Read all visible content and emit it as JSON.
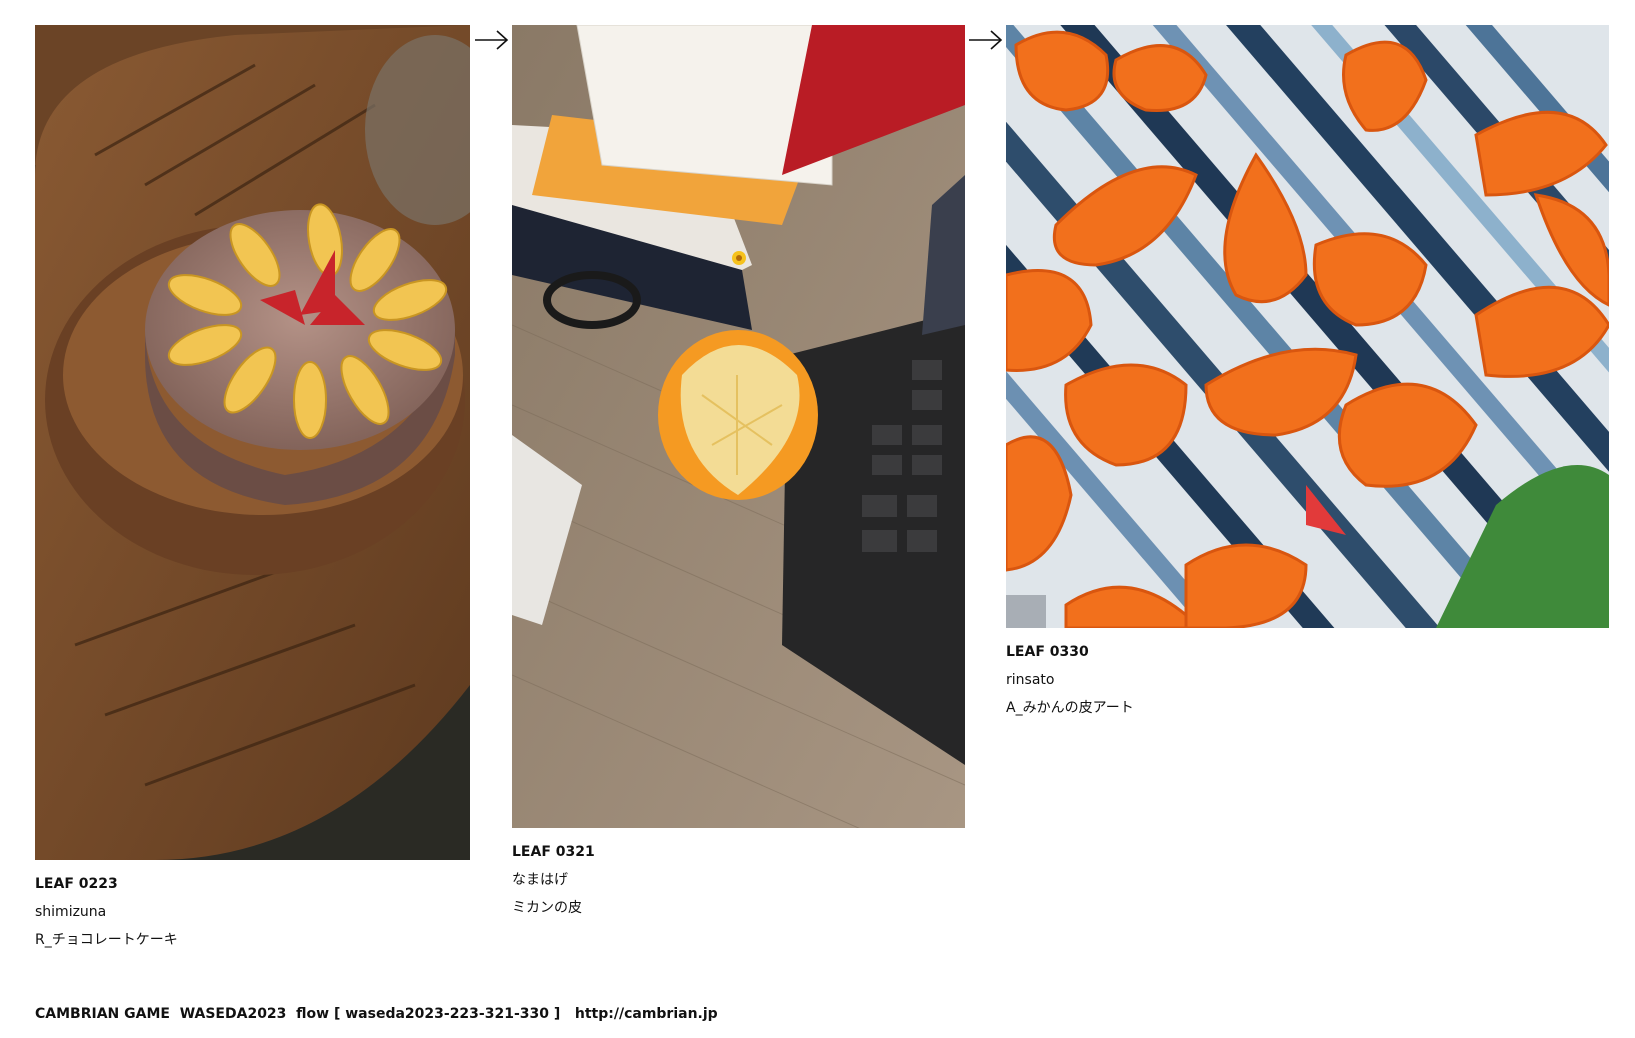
{
  "leaves": [
    {
      "id": "LEAF 0223",
      "author": "shimizuna",
      "title": "R_チョコレートケーキ",
      "image": "chocolate-cake-with-orange-slices-photo"
    },
    {
      "id": "LEAF 0321",
      "author": "なまはげ",
      "title": "ミカンの皮",
      "image": "peeled-mandarin-on-desk-photo"
    },
    {
      "id": "LEAF 0330",
      "author": "rinsato",
      "title": "A_みかんの皮アート",
      "image": "orange-peel-art-on-striped-cloth-image"
    }
  ],
  "arrows": [
    "arrow-right-icon",
    "arrow-right-icon"
  ],
  "footer": {
    "text": "CAMBRIAN GAME  WASEDA2023  flow [ waseda2023-223-321-330 ]   http://cambrian.jp"
  },
  "colors": {
    "background": "#ffffff",
    "text": "#111111"
  }
}
